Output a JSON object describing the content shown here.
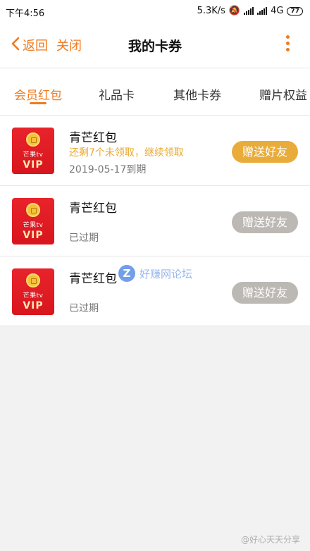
{
  "status_bar": {
    "time": "下午4:56",
    "speed": "5.3K/s",
    "network": "4G",
    "battery": "77"
  },
  "header": {
    "back_label": "返回",
    "close_label": "关闭",
    "title": "我的卡券",
    "more_icon": "more-vertical-icon"
  },
  "tabs": [
    {
      "label": "会员红包",
      "active": true
    },
    {
      "label": "礼品卡",
      "active": false
    },
    {
      "label": "其他卡券",
      "active": false
    },
    {
      "label": "赠片权益",
      "active": false
    }
  ],
  "cards": [
    {
      "title": "青芒红包",
      "note": "还剩7个未领取，继续领取",
      "expiry": "2019-05-17到期",
      "button": "赠送好友",
      "enabled": true,
      "thumb": {
        "brand": "芒果tv",
        "badge": "VIP"
      }
    },
    {
      "title": "青芒红包",
      "note": "",
      "expiry": "已过期",
      "button": "赠送好友",
      "enabled": false,
      "thumb": {
        "brand": "芒果tv",
        "badge": "VIP"
      }
    },
    {
      "title": "青芒红包",
      "note": "",
      "expiry": "已过期",
      "button": "赠送好友",
      "enabled": false,
      "thumb": {
        "brand": "芒果tv",
        "badge": "VIP"
      }
    }
  ],
  "watermarks": {
    "forum_logo": "Z",
    "forum_text": "好赚网论坛",
    "weibo_text": "@好心天天分享"
  },
  "colors": {
    "accent": "#f07a1f",
    "note": "#e9a92d",
    "button_enabled": "#e9ac3a",
    "button_disabled": "#bcb8b4",
    "vip_red": "#e8232b"
  }
}
